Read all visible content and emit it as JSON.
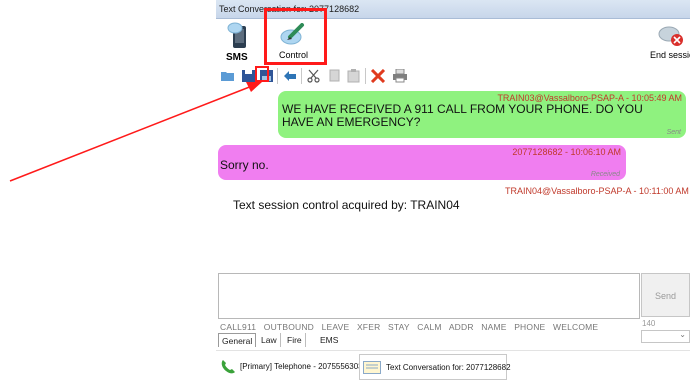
{
  "window": {
    "title": "Text Conversation for: 2077128682"
  },
  "ribbon": {
    "sms_label": "SMS",
    "control_label": "Control",
    "end_session_label": "End session"
  },
  "toolbar": {
    "icons": [
      "open-folder-icon",
      "save-icon",
      "save-as-icon",
      "undo-icon",
      "cut-icon",
      "copy-icon",
      "paste-icon",
      "delete-icon",
      "print-icon"
    ]
  },
  "messages": [
    {
      "meta": "TRAIN03@Vassalboro-PSAP-A - 10:05:49 AM",
      "text": "WE HAVE RECEIVED A 911 CALL FROM YOUR PHONE. DO YOU HAVE AN EMERGENCY?",
      "status": "Sent",
      "color": "#8ff27f"
    },
    {
      "meta": "2077128682 - 10:06:10 AM",
      "text": "Sorry no.",
      "status": "Received",
      "color": "#f07ef0"
    },
    {
      "meta": "TRAIN04@Vassalboro-PSAP-A - 10:11:00 AM",
      "text": "Text session control acquired by: TRAIN04"
    }
  ],
  "composer": {
    "send_label": "Send",
    "char_count": "140"
  },
  "quick_phrases": [
    "CALL911",
    "OUTBOUND",
    "LEAVE",
    "XFER",
    "STAY",
    "CALM",
    "ADDR",
    "NAME",
    "PHONE",
    "WELCOME"
  ],
  "tabs": [
    "General",
    "Law",
    "Fire",
    "EMS"
  ],
  "taskbar": {
    "item1": "[Primary] Telephone - 2075556303",
    "item2": "Text Conversation for: 2077128682"
  },
  "colors": {
    "annotation": "#ff1a1a",
    "sent_bubble": "#8ff27f",
    "received_bubble": "#f07ef0",
    "meta_text": "#c0392b"
  }
}
